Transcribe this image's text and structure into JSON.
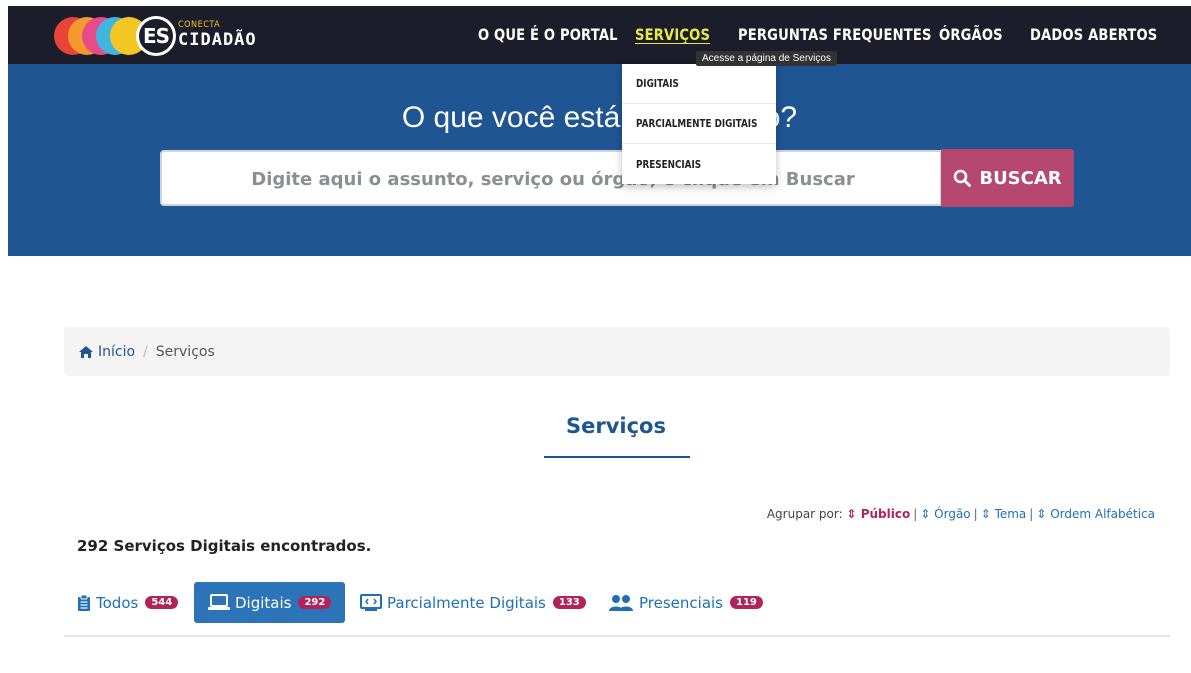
{
  "header": {
    "brand_small": "CONECTA",
    "brand_big": "CIDADÃO",
    "logo_mark": "ES",
    "nav": [
      {
        "label": "O QUE É O PORTAL"
      },
      {
        "label": "SERVIÇOS"
      },
      {
        "label": "PERGUNTAS FREQUENTES"
      },
      {
        "label": "ÓRGÃOS"
      },
      {
        "label": "DADOS ABERTOS"
      }
    ],
    "tooltip": "Acesse a página de Serviços",
    "colors": {
      "bar": "#1c1d2b",
      "active": "#e8e84a"
    }
  },
  "dropdown": {
    "items": [
      "DIGITAIS",
      "PARCIALMENTE DIGITAIS",
      "PRESENCIAIS"
    ]
  },
  "hero": {
    "title": "O que você está procurando?",
    "search_placeholder": "Digite aqui o assunto, serviço ou órgão, e clique em Buscar",
    "search_button": "BUSCAR",
    "colors": {
      "background": "#1f5592",
      "button": "#b6476f"
    }
  },
  "breadcrumb": {
    "home": "Início",
    "separator": "/",
    "current": "Serviços"
  },
  "page": {
    "title": "Serviços",
    "groupby_label": "Agrupar por:",
    "groupby_options": [
      "Público",
      "Órgão",
      "Tema",
      "Ordem Alfabética"
    ],
    "groupby_active": "Público",
    "result_text": "292 Serviços Digitais encontrados."
  },
  "tabs": [
    {
      "label": "Todos",
      "count": "544",
      "icon": "clipboard-list-icon"
    },
    {
      "label": "Digitais",
      "count": "292",
      "icon": "laptop-icon"
    },
    {
      "label": "Parcialmente Digitais",
      "count": "133",
      "icon": "code-monitor-icon"
    },
    {
      "label": "Presenciais",
      "count": "119",
      "icon": "users-icon"
    }
  ]
}
